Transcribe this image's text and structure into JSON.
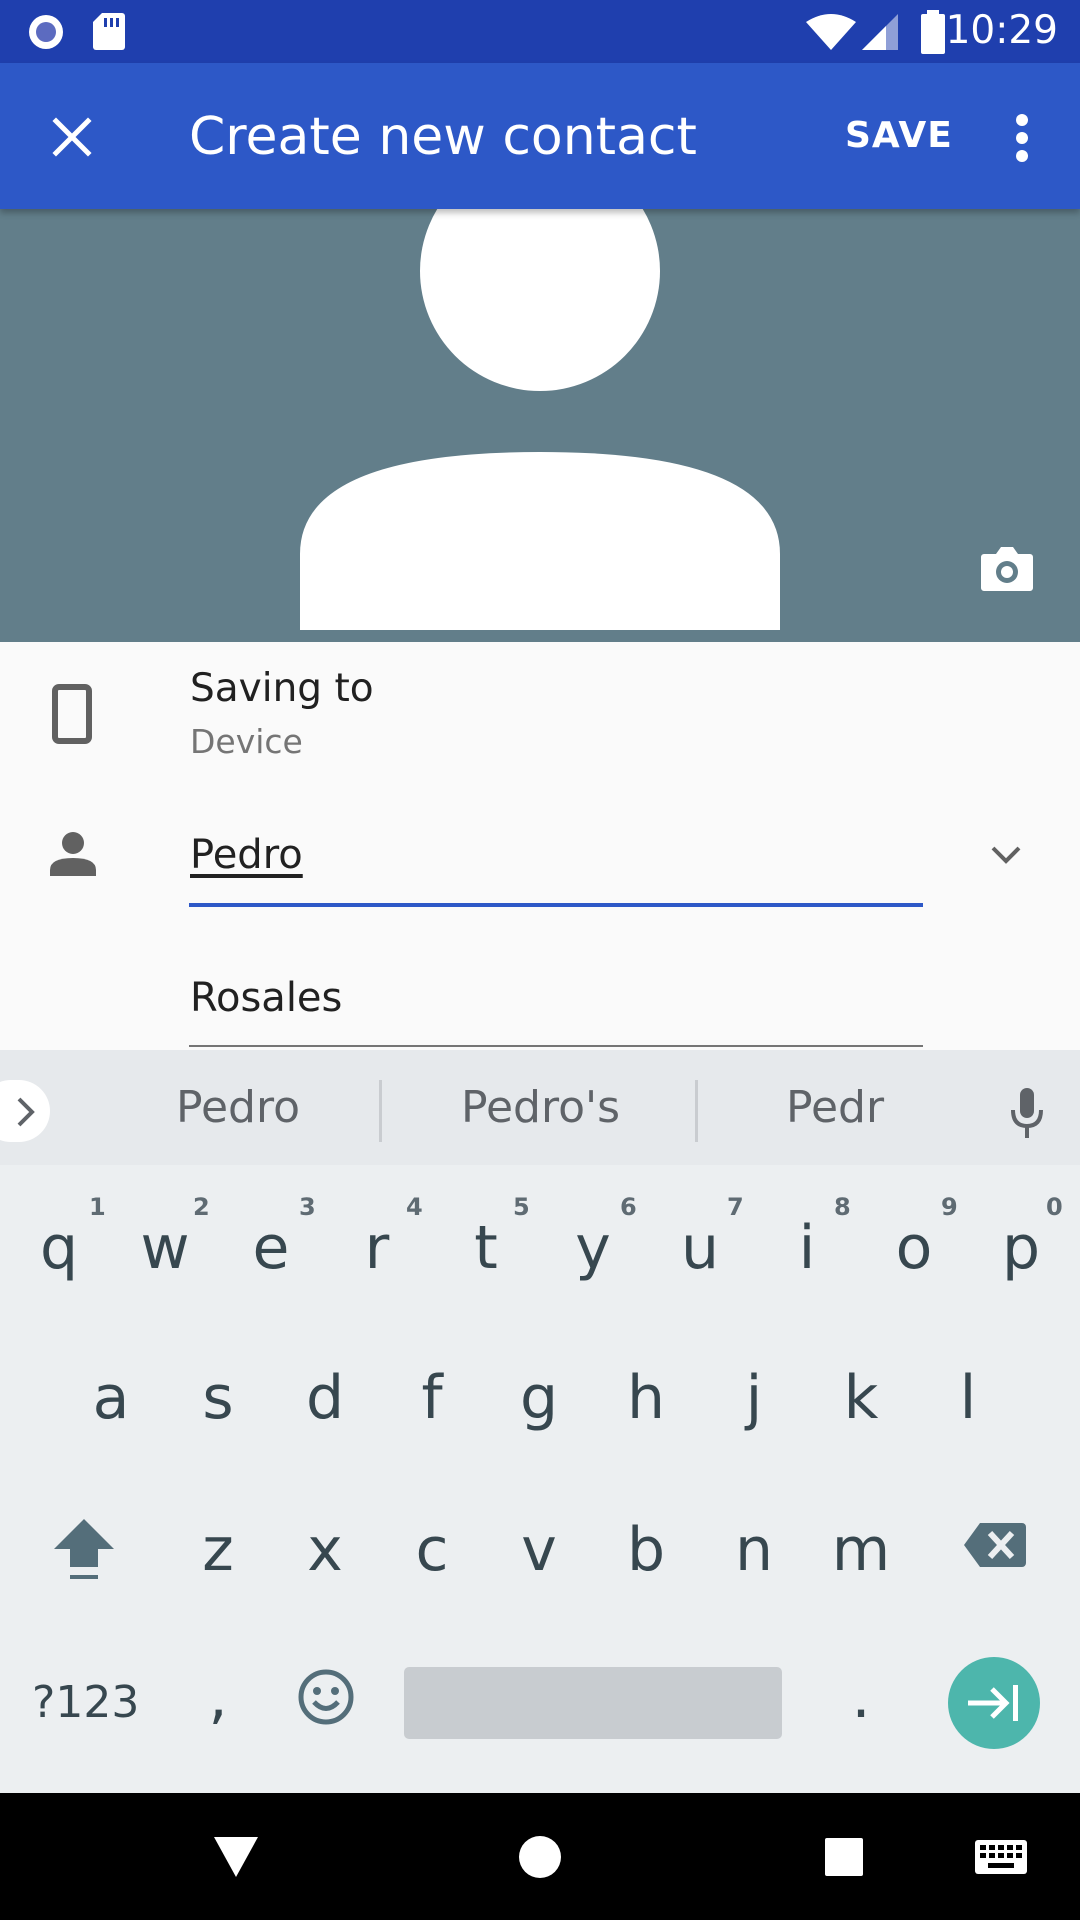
{
  "status_bar": {
    "time": "10:29"
  },
  "app_bar": {
    "title": "Create new contact",
    "save_label": "SAVE"
  },
  "form": {
    "saving_to_label": "Saving to",
    "saving_to_value": "Device",
    "first_name": "Pedro",
    "last_name": "Rosales"
  },
  "suggestions": [
    "Pedro",
    "Pedro's",
    "Pedr"
  ],
  "keyboard": {
    "row1": [
      {
        "key": "q",
        "hint": "1"
      },
      {
        "key": "w",
        "hint": "2"
      },
      {
        "key": "e",
        "hint": "3"
      },
      {
        "key": "r",
        "hint": "4"
      },
      {
        "key": "t",
        "hint": "5"
      },
      {
        "key": "y",
        "hint": "6"
      },
      {
        "key": "u",
        "hint": "7"
      },
      {
        "key": "i",
        "hint": "8"
      },
      {
        "key": "o",
        "hint": "9"
      },
      {
        "key": "p",
        "hint": "0"
      }
    ],
    "row2": [
      "a",
      "s",
      "d",
      "f",
      "g",
      "h",
      "j",
      "k",
      "l"
    ],
    "row3": [
      "z",
      "x",
      "c",
      "v",
      "b",
      "n",
      "m"
    ],
    "symbols_label": "?123",
    "comma": ",",
    "period": "."
  },
  "colors": {
    "status_bar": "#1f3fae",
    "app_bar": "#2d58c7",
    "photo_bg": "#627e8a",
    "accent_teal": "#4db6ac",
    "field_focus": "#2d58c7"
  }
}
